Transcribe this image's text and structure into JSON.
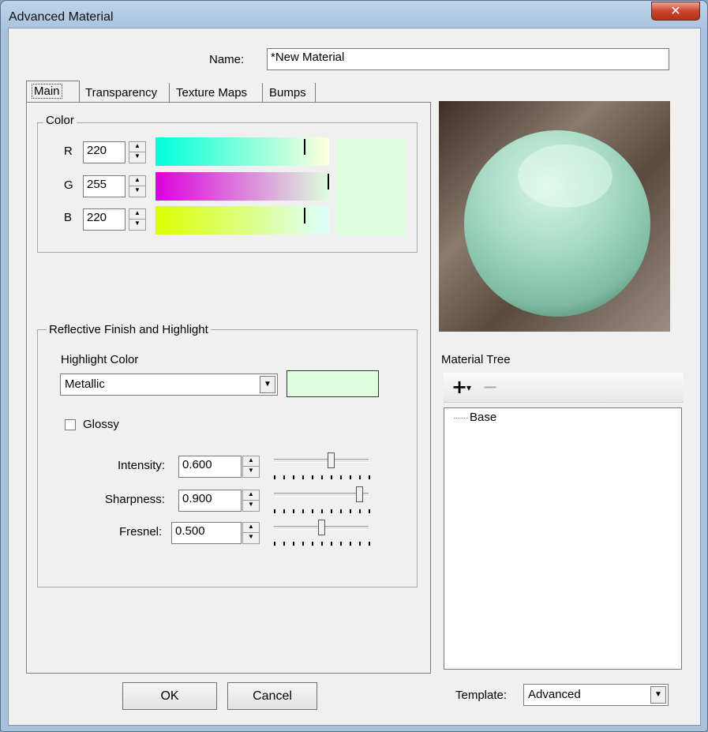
{
  "window": {
    "title": "Advanced Material",
    "close_glyph": "✕"
  },
  "name_field": {
    "label": "Name:",
    "value": "*New Material"
  },
  "tabs": [
    {
      "label": "Main"
    },
    {
      "label": "Transparency"
    },
    {
      "label": "Texture Maps"
    },
    {
      "label": "Bumps"
    }
  ],
  "color_group": {
    "label": "Color",
    "channels": [
      {
        "label": "R",
        "value": "220",
        "level": 220
      },
      {
        "label": "G",
        "value": "255",
        "level": 255
      },
      {
        "label": "B",
        "value": "220",
        "level": 220
      }
    ],
    "swatch_color": "#dcffdc"
  },
  "reflective_group": {
    "label": "Reflective Finish and Highlight",
    "highlight_color_label": "Highlight Color",
    "highlight_type": "Metallic",
    "highlight_swatch": "#dcffdc",
    "glossy_label": "Glossy",
    "glossy_checked": false,
    "params": [
      {
        "label": "Intensity:",
        "value": "0.600",
        "level": 0.6
      },
      {
        "label": "Sharpness:",
        "value": "0.900",
        "level": 0.9
      },
      {
        "label": "Fresnel:",
        "value": "0.500",
        "level": 0.5
      }
    ]
  },
  "material_tree": {
    "label": "Material Tree",
    "add_icon": "+",
    "add_dropdown": "▾",
    "remove_icon": "−",
    "items": [
      {
        "label": "Base"
      }
    ]
  },
  "buttons": {
    "ok": "OK",
    "cancel": "Cancel"
  },
  "template": {
    "label": "Template:",
    "value": "Advanced"
  },
  "spin_glyphs": {
    "up": "▲",
    "down": "▼"
  },
  "dropdown_glyph": "▼"
}
